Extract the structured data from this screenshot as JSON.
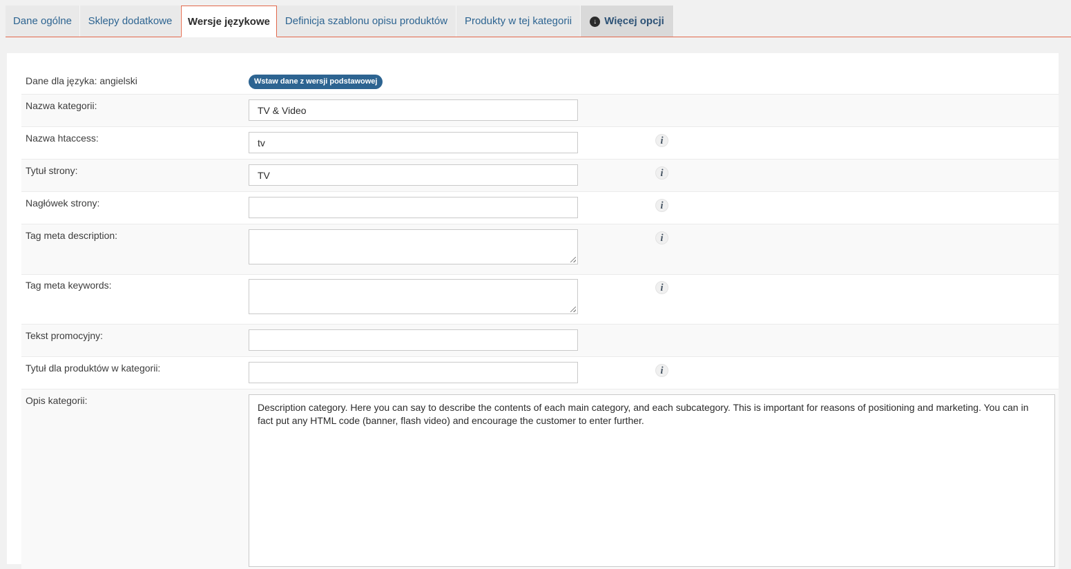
{
  "tabs": [
    {
      "label": "Dane ogólne"
    },
    {
      "label": "Sklepy dodatkowe"
    },
    {
      "label": "Wersje językowe"
    },
    {
      "label": "Definicja szablonu opisu produktów"
    },
    {
      "label": "Produkty w tej kategorii"
    },
    {
      "label": "Więcej opcji",
      "icon": "circle-arrow-down-icon"
    }
  ],
  "form": {
    "language_label": "Dane dla języka: angielski",
    "insert_button": "Wstaw dane z wersji podstawowej",
    "fields": [
      {
        "label": "Nazwa kategorii:",
        "value": "TV & Video"
      },
      {
        "label": "Nazwa htaccess:",
        "value": "tv"
      },
      {
        "label": "Tytuł strony:",
        "value": "TV"
      },
      {
        "label": "Nagłówek strony:",
        "value": ""
      },
      {
        "label": "Tag meta description:",
        "value": ""
      },
      {
        "label": "Tag meta keywords:",
        "value": ""
      },
      {
        "label": "Tekst promocyjny:",
        "value": ""
      },
      {
        "label": "Tytuł dla produktów w kategorii:",
        "value": ""
      },
      {
        "label": "Opis kategorii:",
        "value": "Description category. Here you can say to describe the contents of each main category, and each subcategory. This is important for reasons of positioning and marketing. You can in fact put any HTML code (banner, flash video) and encourage the customer to enter further."
      }
    ],
    "info_icon": "info-icon"
  },
  "colors": {
    "accent_tab_border": "#e2674a",
    "link_blue": "#2d6491",
    "button_blue": "#2d6491"
  }
}
